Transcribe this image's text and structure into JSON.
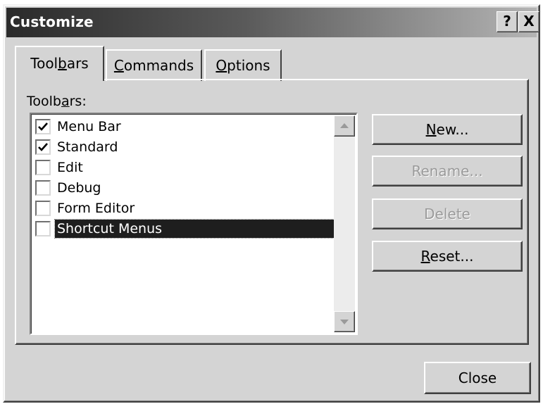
{
  "window": {
    "title": "Customize",
    "help_button": "?",
    "close_button": "X"
  },
  "tabs": [
    {
      "label": "Toolbars",
      "hotkey_prefix": "Tool",
      "hotkey": "b",
      "hotkey_suffix": "ars",
      "active": true
    },
    {
      "label": "Commands",
      "hotkey_prefix": "",
      "hotkey": "C",
      "hotkey_suffix": "ommands",
      "active": false
    },
    {
      "label": "Options",
      "hotkey_prefix": "",
      "hotkey": "O",
      "hotkey_suffix": "ptions",
      "active": false
    }
  ],
  "list": {
    "label_prefix": "Toolb",
    "label_hotkey": "a",
    "label_suffix": "rs:",
    "items": [
      {
        "label": "Menu Bar",
        "checked": true,
        "selected": false
      },
      {
        "label": "Standard",
        "checked": true,
        "selected": false
      },
      {
        "label": "Edit",
        "checked": false,
        "selected": false
      },
      {
        "label": "Debug",
        "checked": false,
        "selected": false
      },
      {
        "label": "Form Editor",
        "checked": false,
        "selected": false
      },
      {
        "label": "Shortcut Menus",
        "checked": false,
        "selected": true
      }
    ]
  },
  "buttons": {
    "new": {
      "hotkey": "N",
      "rest": "ew...",
      "enabled": true
    },
    "rename": {
      "label": "Rename...",
      "enabled": false
    },
    "delete": {
      "label": "Delete",
      "enabled": false
    },
    "reset": {
      "hotkey": "R",
      "rest": "eset...",
      "enabled": true
    },
    "close": {
      "label": "Close",
      "enabled": true
    }
  },
  "icons": {
    "check": "check-mark-icon",
    "scroll_up": "scroll-up-arrow-icon",
    "scroll_down": "scroll-down-arrow-icon"
  }
}
